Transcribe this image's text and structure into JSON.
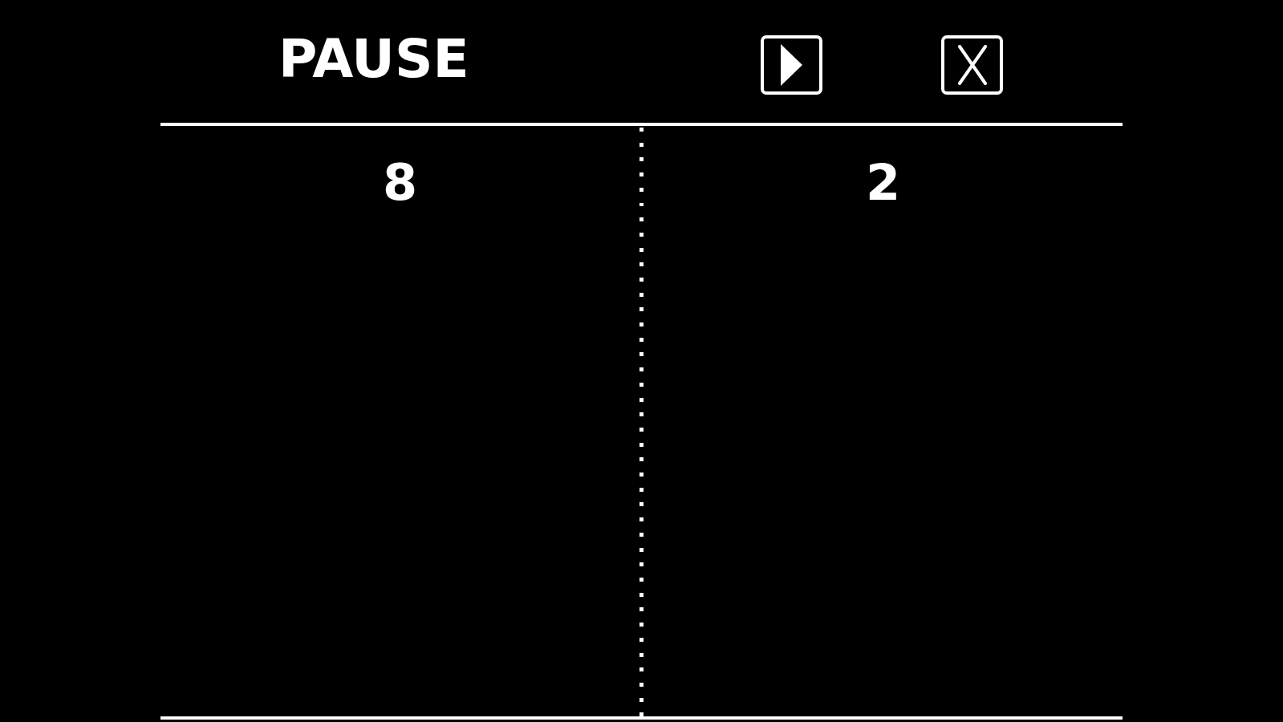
{
  "header": {
    "title": "PAUSE",
    "buttons": [
      {
        "kind": "play"
      },
      {
        "kind": "close"
      }
    ]
  },
  "scores": [
    "8",
    "2"
  ]
}
